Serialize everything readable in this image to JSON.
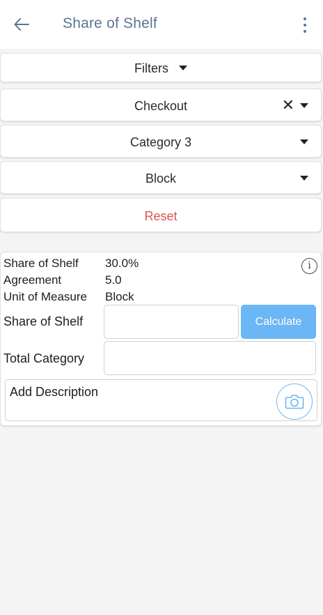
{
  "header": {
    "title": "Share of Shelf"
  },
  "filters": {
    "toggle_label": "Filters",
    "store": {
      "value": "Checkout"
    },
    "category": {
      "value": "Category 3"
    },
    "unit": {
      "value": "Block"
    },
    "reset_label": "Reset"
  },
  "details": {
    "rows": [
      {
        "label": "Share of Shelf",
        "value": "30.0%"
      },
      {
        "label": "Agreement",
        "value": "5.0"
      },
      {
        "label": "Unit of Measure",
        "value": "Block"
      }
    ],
    "share_field_label": "Share of Shelf",
    "share_field_value": "",
    "calculate_label": "Calculate",
    "total_field_label": "Total Category",
    "total_field_value": "",
    "description_placeholder": "Add Description"
  },
  "colors": {
    "title": "#5a7591",
    "reset": "#d9534f",
    "accent": "#6bb6f5"
  },
  "icons": [
    "arrow-left-icon",
    "more-vertical-icon",
    "caret-down-icon",
    "close-icon",
    "info-icon",
    "camera-icon"
  ]
}
